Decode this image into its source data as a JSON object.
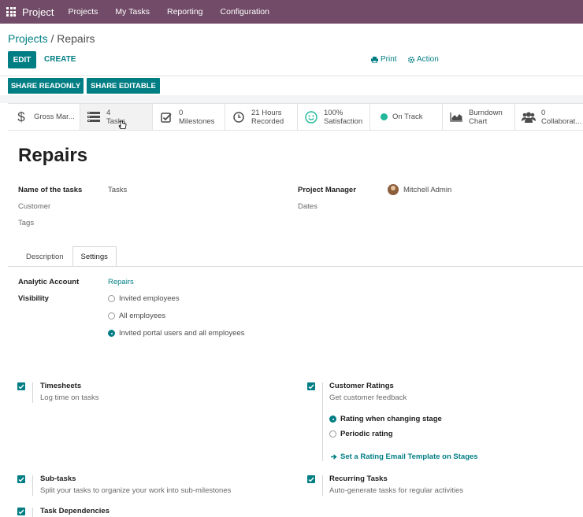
{
  "navbar": {
    "brand": "Project",
    "menu": [
      "Projects",
      "My Tasks",
      "Reporting",
      "Configuration"
    ]
  },
  "breadcrumb": {
    "parent": "Projects",
    "separator": " / ",
    "current": "Repairs"
  },
  "buttons": {
    "edit": "EDIT",
    "create": "CREATE",
    "print": "Print",
    "action": "Action",
    "share_readonly": "SHARE READONLY",
    "share_editable": "SHARE EDITABLE"
  },
  "smart_buttons": [
    {
      "line1": "Gross Mar...",
      "line2": "",
      "icon": "dollar-icon"
    },
    {
      "line1": "4",
      "line2": "Tasks",
      "icon": "tasks-icon"
    },
    {
      "line1": "0",
      "line2": "Milestones",
      "icon": "check-square-icon"
    },
    {
      "line1": "21 Hours",
      "line2": "Recorded",
      "icon": "clock-icon"
    },
    {
      "line1": "100%",
      "line2": "Satisfaction",
      "icon": "smile-icon"
    },
    {
      "line1": "On Track",
      "line2": "",
      "icon": "status-dot-icon"
    },
    {
      "line1": "Burndown",
      "line2": "Chart",
      "icon": "area-chart-icon"
    },
    {
      "line1": "0",
      "line2": "Collaborat...",
      "icon": "users-icon"
    }
  ],
  "form": {
    "title": "Repairs",
    "fields": {
      "name_of_tasks_label": "Name of the tasks",
      "name_of_tasks_value": "Tasks",
      "customer_label": "Customer",
      "tags_label": "Tags",
      "project_manager_label": "Project Manager",
      "project_manager_value": "Mitchell Admin",
      "dates_label": "Dates"
    },
    "tabs": [
      "Description",
      "Settings"
    ],
    "active_tab": "Settings",
    "settings": {
      "analytic_account_label": "Analytic Account",
      "analytic_account_value": "Repairs",
      "visibility_label": "Visibility",
      "visibility_options": [
        "Invited employees",
        "All employees",
        "Invited portal users and all employees"
      ],
      "visibility_selected": 2,
      "timesheets_title": "Timesheets",
      "timesheets_desc": "Log time on tasks",
      "customer_ratings_title": "Customer Ratings",
      "customer_ratings_desc": "Get customer feedback",
      "rating_options": [
        "Rating when changing stage",
        "Periodic rating"
      ],
      "rating_selected": 0,
      "rating_template_link": "Set a Rating Email Template on Stages",
      "subtasks_title": "Sub-tasks",
      "subtasks_desc": "Split your tasks to organize your work into sub-milestones",
      "recurring_title": "Recurring Tasks",
      "recurring_desc": "Auto-generate tasks for regular activities",
      "dependencies_title": "Task Dependencies"
    }
  },
  "colors": {
    "navbar": "#714b67",
    "accent": "#017e84",
    "status_on_track": "#21b799"
  }
}
